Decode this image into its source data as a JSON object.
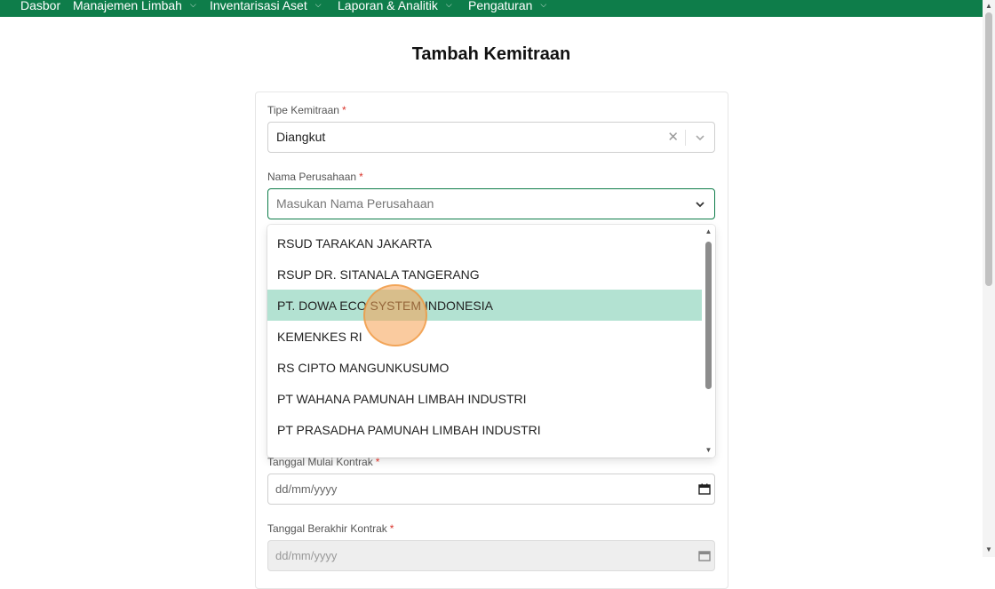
{
  "navbar": {
    "items": [
      {
        "label": "Dasbor",
        "has_dropdown": false
      },
      {
        "label": "Manajemen Limbah",
        "has_dropdown": true
      },
      {
        "label": "Inventarisasi Aset",
        "has_dropdown": true
      },
      {
        "label": "Laporan & Analitik",
        "has_dropdown": true
      },
      {
        "label": "Pengaturan",
        "has_dropdown": true
      }
    ],
    "background": "#0e7d4a"
  },
  "page": {
    "title": "Tambah Kemitraan"
  },
  "form": {
    "tipe_kemitraan": {
      "label": "Tipe Kemitraan",
      "required_mark": "*",
      "value": "Diangkut"
    },
    "nama_perusahaan": {
      "label": "Nama Perusahaan",
      "required_mark": "*",
      "placeholder": "Masukan Nama Perusahaan",
      "options": [
        "RSUD TARAKAN JAKARTA",
        "RSUP DR. SITANALA TANGERANG",
        "PT. DOWA ECO SYSTEM INDONESIA",
        "KEMENKES RI",
        "RS CIPTO MANGUNKUSUMO",
        "PT WAHANA PAMUNAH LIMBAH INDUSTRI",
        "PT PRASADHA PAMUNAH LIMBAH INDUSTRI"
      ],
      "highlighted_option": "PT. DOWA ECO SYSTEM INDONESIA"
    },
    "tanggal_mulai": {
      "label": "Tanggal Mulai Kontrak",
      "required_mark": "*",
      "placeholder": "dd/mm/yyyy"
    },
    "tanggal_berakhir": {
      "label": "Tanggal Berakhir Kontrak",
      "required_mark": "*",
      "placeholder": "dd/mm/yyyy"
    }
  },
  "colors": {
    "accent": "#0e7d4a",
    "highlight": "#b3e2d2",
    "required": "#d9342b"
  }
}
